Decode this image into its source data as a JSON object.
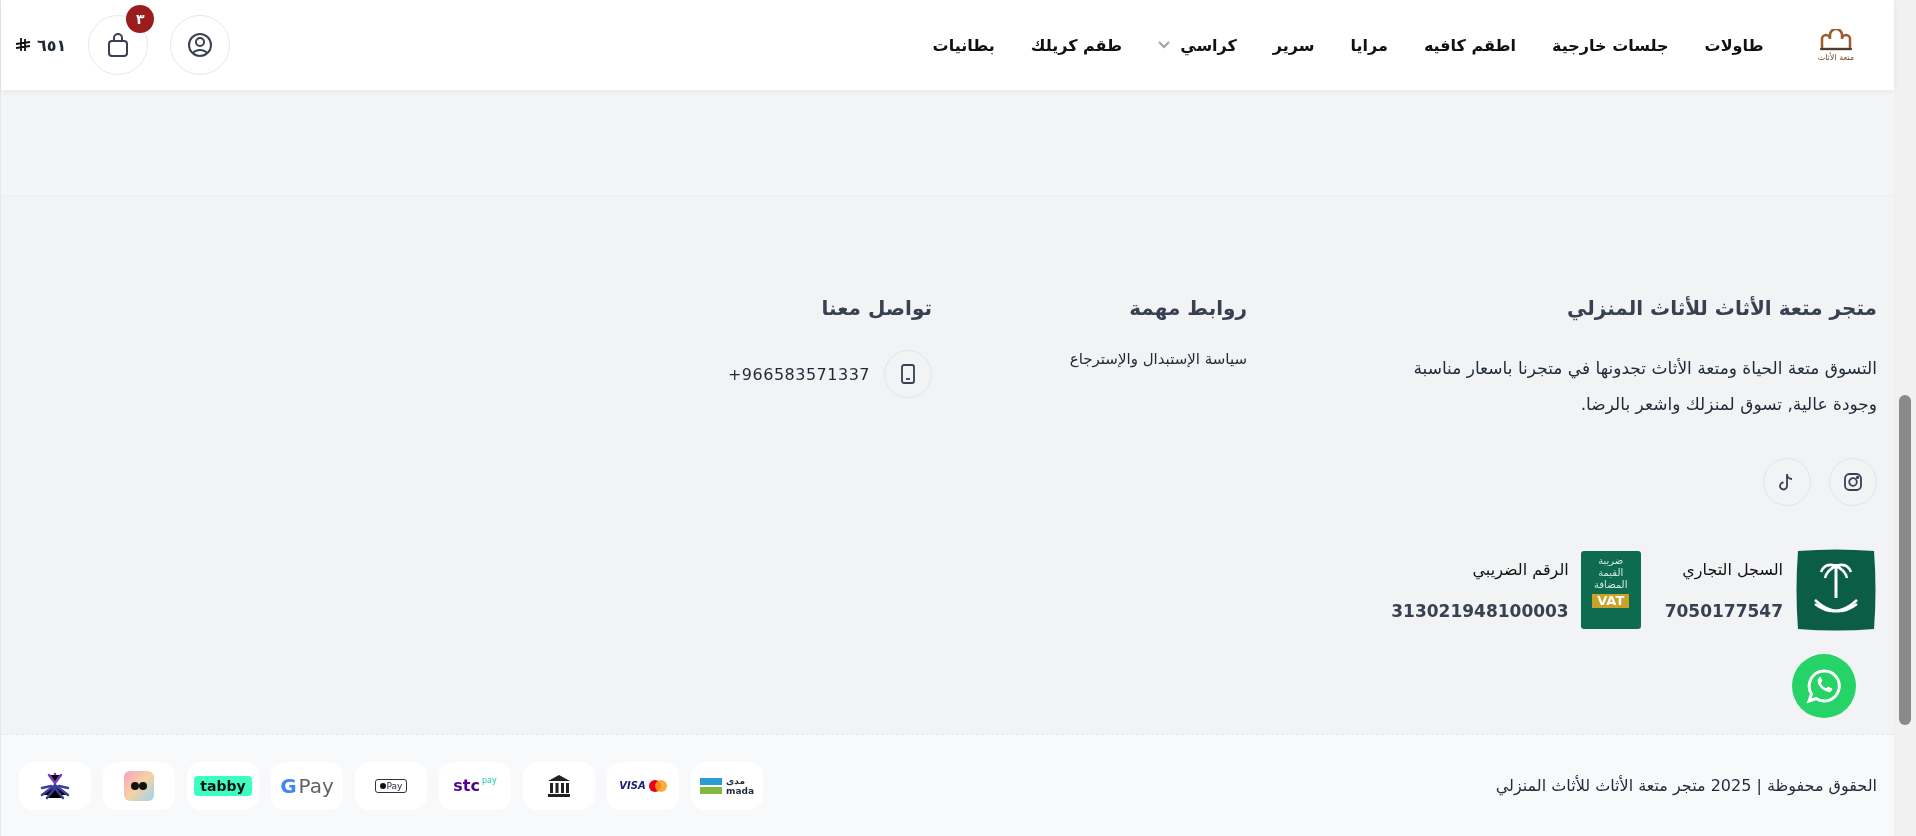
{
  "header": {
    "logo_caption": "متعة الأثاث",
    "nav": [
      {
        "label": "طاولات",
        "has_dropdown": false
      },
      {
        "label": "جلسات خارجية",
        "has_dropdown": false
      },
      {
        "label": "اطقم كافيه",
        "has_dropdown": false
      },
      {
        "label": "مرايا",
        "has_dropdown": false
      },
      {
        "label": "سرير",
        "has_dropdown": false
      },
      {
        "label": "كراسي",
        "has_dropdown": true
      },
      {
        "label": "طقم كريلك",
        "has_dropdown": false
      },
      {
        "label": "بطانيات",
        "has_dropdown": false
      }
    ],
    "cart": {
      "count": "٣"
    },
    "price": "٦٥١"
  },
  "footer": {
    "about": {
      "title": "متجر متعة الأثاث للأثاث المنزلي",
      "text": "التسوق متعة الحياة ومتعة الأثاث تجدونها في متجرنا باسعار مناسبة وجودة عالية, تسوق لمنزلك واشعر بالرضا."
    },
    "social": [
      {
        "kind": "instagram"
      },
      {
        "kind": "tiktok"
      }
    ],
    "registry": [
      {
        "kind": "commercial",
        "label": "السجل التجاري",
        "number": "7050177547"
      },
      {
        "kind": "vat",
        "label": "الرقم الضريبي",
        "number": "313021948100003",
        "logo_lines": [
          "ضريبة",
          "القيمة",
          "المضافة"
        ],
        "logo_badge": "VAT"
      }
    ],
    "links": {
      "title": "روابط مهمة",
      "items": [
        "سياسة الإستبدال والإسترجاع"
      ]
    },
    "contact": {
      "title": "تواصل معنا",
      "items": [
        {
          "kind": "phone",
          "value": "+966583571337"
        }
      ]
    }
  },
  "bottom_bar": {
    "copyright": "الحقوق محفوظة | 2025 متجر متعة الأثاث للأثاث المنزلي",
    "payments": [
      {
        "kind": "mada",
        "texts": [
          "مدى",
          "mada"
        ]
      },
      {
        "kind": "cards",
        "texts": [
          "VISA"
        ]
      },
      {
        "kind": "bank"
      },
      {
        "kind": "stcpay",
        "texts": [
          "stc",
          "pay"
        ]
      },
      {
        "kind": "applepay",
        "texts": [
          "Pay"
        ]
      },
      {
        "kind": "gpay",
        "texts": [
          "G",
          "Pay"
        ]
      },
      {
        "kind": "tabby",
        "texts": [
          "tabby"
        ]
      },
      {
        "kind": "app"
      },
      {
        "kind": "star"
      }
    ]
  }
}
